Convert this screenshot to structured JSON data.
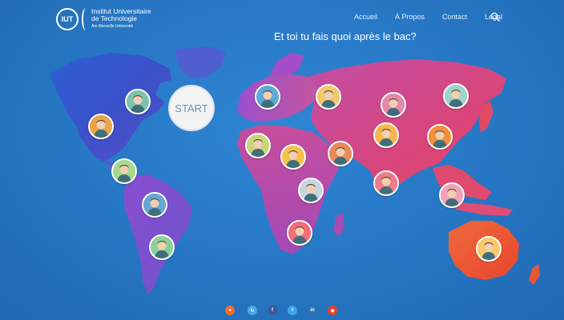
{
  "header": {
    "logo_mark": "IUT",
    "logo_line1": "Institut Universitaire",
    "logo_line2": "de Technologie",
    "logo_line3": "Aix-Marseille Université",
    "nav": [
      "Accueil",
      "À Propos",
      "Contact",
      "Legal"
    ],
    "search_icon": "search-icon"
  },
  "headline": "Et toi tu fais quoi après le bac?",
  "start_label": "START",
  "markers": [
    {
      "icon": "scientist-avatar-icon",
      "bg": "#7cc3ad"
    },
    {
      "icon": "worker-hardhat-avatar-icon",
      "bg": "#e8a54a"
    },
    {
      "icon": "aviator-avatar-icon",
      "bg": "#5fa9d9"
    },
    {
      "icon": "bald-man-avatar-icon",
      "bg": "#f0c96b"
    },
    {
      "icon": "doctor-avatar-icon",
      "bg": "#e48aa8"
    },
    {
      "icon": "surgeon-avatar-icon",
      "bg": "#9fd3c8"
    },
    {
      "icon": "engineer-avatar-icon",
      "bg": "#a7d98d"
    },
    {
      "icon": "chef-avatar-icon",
      "bg": "#c7d67a"
    },
    {
      "icon": "construction-worker-avatar-icon",
      "bg": "#f2c14e"
    },
    {
      "icon": "pilot-avatar-icon",
      "bg": "#e88a5a"
    },
    {
      "icon": "hazmat-avatar-icon",
      "bg": "#f6b84d"
    },
    {
      "icon": "firefighter-avatar-icon",
      "bg": "#f28e3c"
    },
    {
      "icon": "nurse-avatar-icon",
      "bg": "#c6d5e0"
    },
    {
      "icon": "soldier-avatar-icon",
      "bg": "#ef7a8a"
    },
    {
      "icon": "businesswoman-avatar-icon",
      "bg": "#f1a1b8"
    },
    {
      "icon": "welder-avatar-icon",
      "bg": "#65a7d6"
    },
    {
      "icon": "police-avatar-icon",
      "bg": "#f26e7a"
    },
    {
      "icon": "agent-avatar-icon",
      "bg": "#8ccf9b"
    },
    {
      "icon": "astronaut-avatar-icon",
      "bg": "#f9c86a"
    }
  ],
  "social": [
    {
      "name": "blog-icon",
      "glyph": "●",
      "color": "#f26d2d"
    },
    {
      "name": "share-icon",
      "glyph": "↻",
      "color": "#4aa6e8"
    },
    {
      "name": "facebook-icon",
      "glyph": "f",
      "color": "#3b5998"
    },
    {
      "name": "twitter-icon",
      "glyph": "t",
      "color": "#3aa6e8"
    },
    {
      "name": "linkedin-icon",
      "glyph": "in",
      "color": "#2b73b1"
    },
    {
      "name": "extra-icon",
      "glyph": "◆",
      "color": "#e0452b"
    }
  ]
}
